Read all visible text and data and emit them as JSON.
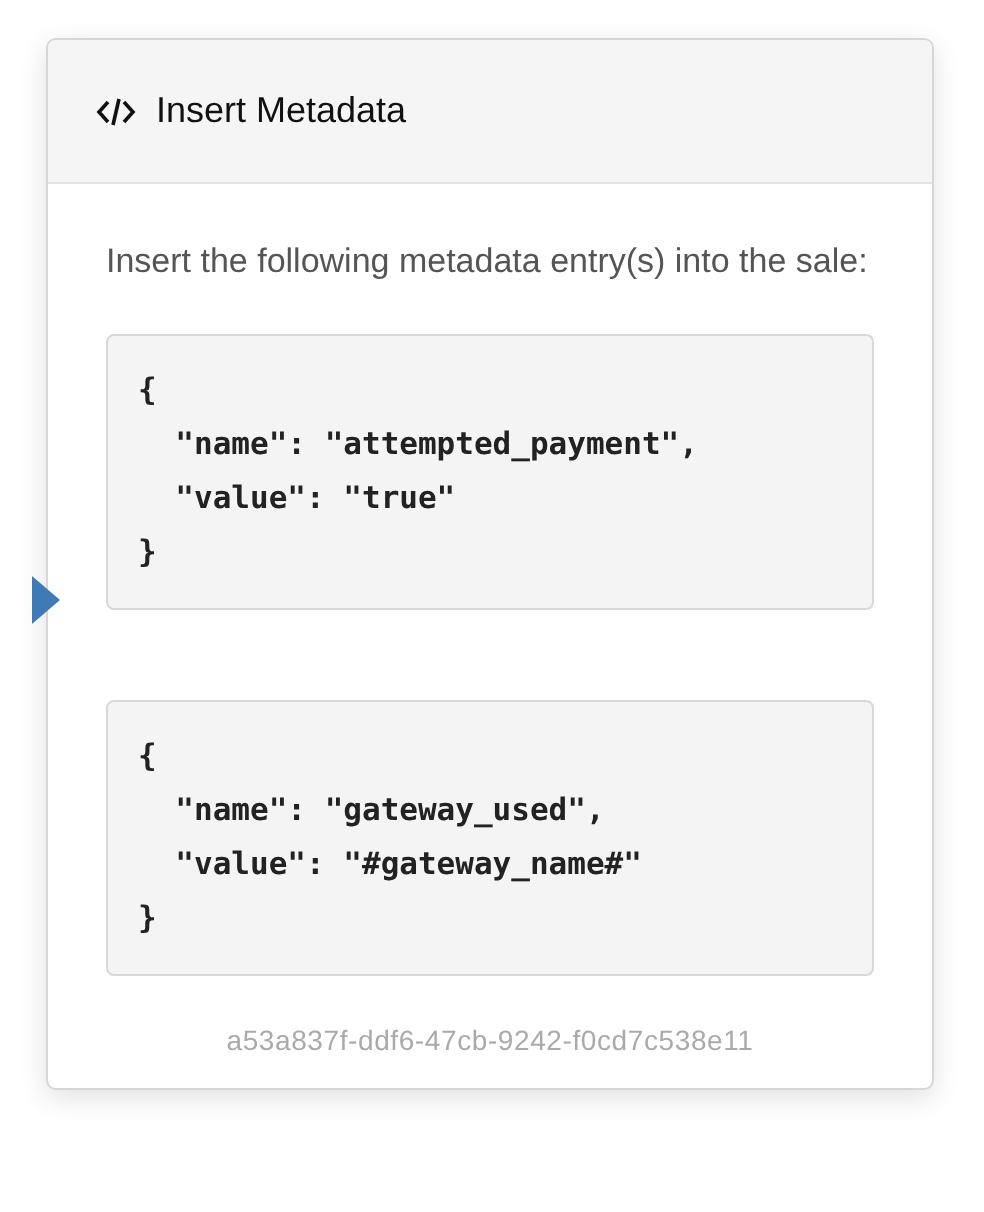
{
  "panel": {
    "title": "Insert Metadata",
    "description": "Insert the following metadata entry(s) into the sale:",
    "code_blocks": [
      {
        "code": "{\n  \"name\": \"attempted_payment\",\n  \"value\": \"true\"\n}"
      },
      {
        "code": "{\n  \"name\": \"gateway_used\",\n  \"value\": \"#gateway_name#\"\n}"
      }
    ],
    "identifier": "a53a837f-ddf6-47cb-9242-f0cd7c538e11"
  }
}
